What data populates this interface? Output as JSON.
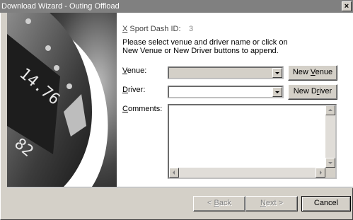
{
  "window": {
    "title": "Download Wizard - Outing Offload",
    "close_glyph": "×"
  },
  "header": {
    "sport_dash_prefix": "X",
    "sport_dash_label": " Sport Dash ID:",
    "sport_dash_value": "3",
    "instruction": "Please select venue and driver name or click on New Venue or New Driver buttons to append."
  },
  "form": {
    "venue": {
      "label_u": "V",
      "label_rest": "enue:",
      "value": ""
    },
    "driver": {
      "label_u": "D",
      "label_rest": "river:",
      "value": ""
    },
    "comments": {
      "label_u": "C",
      "label_rest": "omments:",
      "value": ""
    }
  },
  "buttons": {
    "new_venue_pre": "New ",
    "new_venue_u": "V",
    "new_venue_post": "enue",
    "new_driver_pre": "New D",
    "new_driver_u": "r",
    "new_driver_post": "iver",
    "back_pre": "< ",
    "back_u": "B",
    "back_post": "ack",
    "next_u": "N",
    "next_post": "ext >",
    "cancel": "Cancel"
  },
  "hero": {
    "dash_digits_top": "14.76",
    "dash_digits_bottom": "82"
  }
}
